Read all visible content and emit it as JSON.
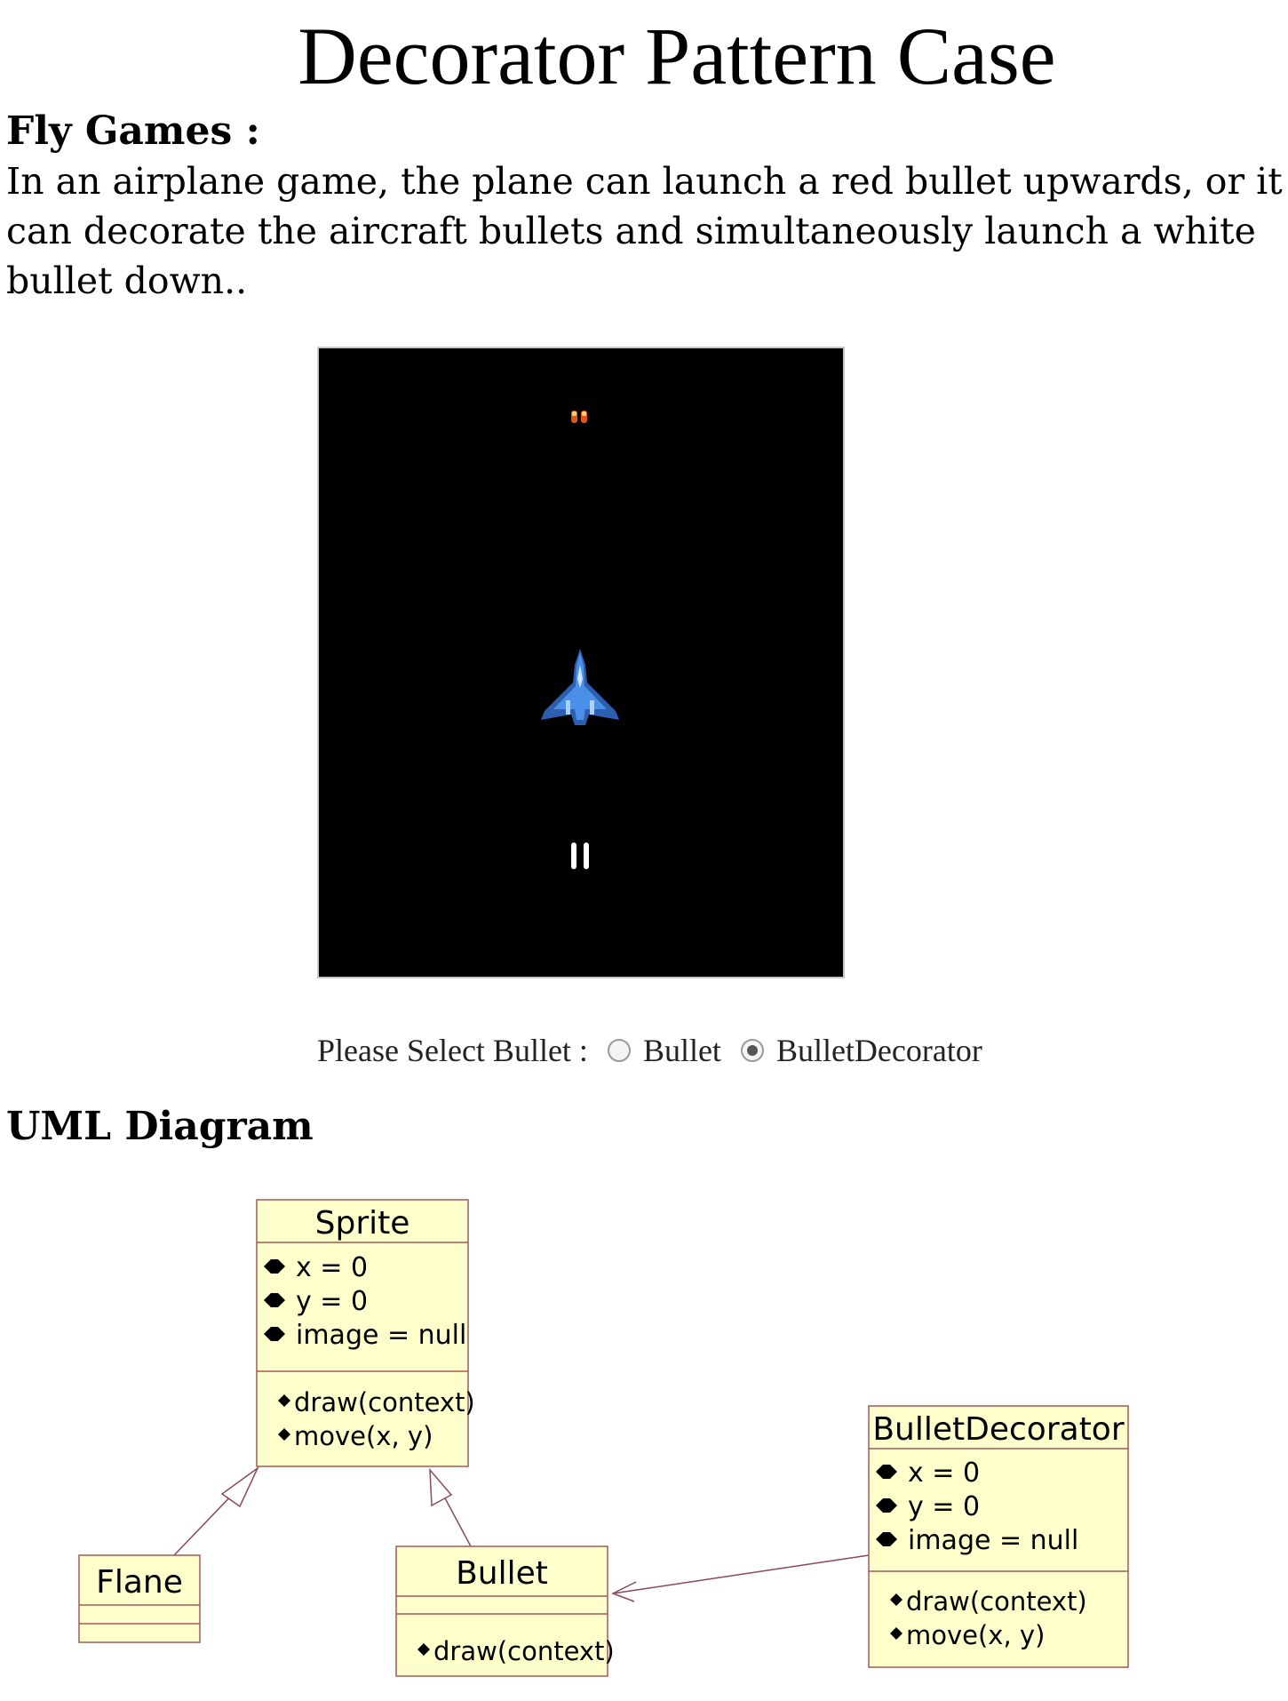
{
  "title": "Decorator Pattern Case",
  "fly_games": {
    "heading": "Fly Games :",
    "description": "In an airplane game, the plane can launch a red bullet upwards, or it can decorate the aircraft bullets and simultaneously launch a white bullet down.."
  },
  "bullet_select": {
    "label": "Please Select Bullet :",
    "options": [
      {
        "label": "Bullet",
        "selected": false
      },
      {
        "label": "BulletDecorator",
        "selected": true
      }
    ]
  },
  "uml": {
    "heading": "UML Diagram",
    "classes": {
      "sprite": {
        "name": "Sprite",
        "attributes": [
          "x = 0",
          "y = 0",
          "image = null"
        ],
        "methods": [
          "draw(context)",
          "move(x, y)"
        ]
      },
      "flane": {
        "name": "Flane",
        "attributes": [],
        "methods": []
      },
      "bullet": {
        "name": "Bullet",
        "attributes": [],
        "methods": [
          "draw(context)"
        ]
      },
      "bullet_decorator": {
        "name": "BulletDecorator",
        "attributes": [
          "x = 0",
          "y = 0",
          "image = null"
        ],
        "methods": [
          "draw(context)",
          "move(x, y)"
        ]
      }
    }
  },
  "colors": {
    "uml_fill": "#ffffcc",
    "uml_border": "#a05a5a",
    "canvas_bg": "#000000",
    "red_bullet": "#e0561a",
    "white_bullet": "#ffffff",
    "plane": "#4a90e8"
  }
}
